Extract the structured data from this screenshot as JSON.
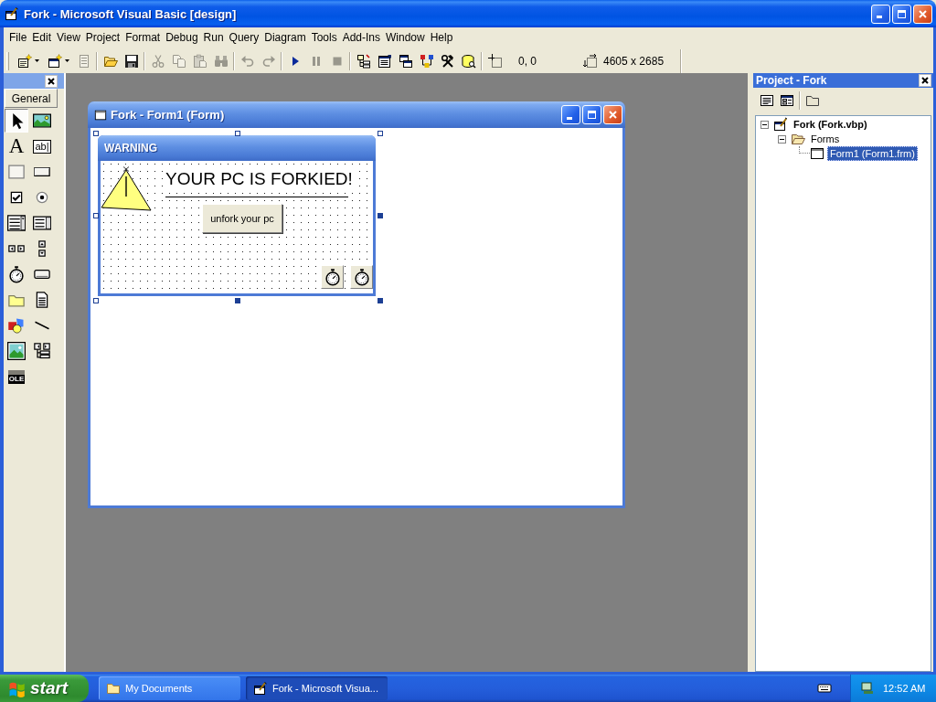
{
  "window": {
    "title": "Fork - Microsoft Visual Basic [design]"
  },
  "menu": [
    "File",
    "Edit",
    "View",
    "Project",
    "Format",
    "Debug",
    "Run",
    "Query",
    "Diagram",
    "Tools",
    "Add-Ins",
    "Window",
    "Help"
  ],
  "toolbar": {
    "groups": [
      [
        {
          "kind": "add-project",
          "dropdown": true,
          "disabled": false
        },
        {
          "kind": "add-form",
          "dropdown": true,
          "disabled": false
        },
        {
          "kind": "menu-editor",
          "disabled": true
        }
      ],
      [
        {
          "kind": "open",
          "disabled": false
        },
        {
          "kind": "save",
          "disabled": false
        }
      ],
      [
        {
          "kind": "cut",
          "disabled": true
        },
        {
          "kind": "copy",
          "disabled": true
        },
        {
          "kind": "paste",
          "disabled": true
        },
        {
          "kind": "find",
          "disabled": true
        }
      ],
      [
        {
          "kind": "undo",
          "disabled": true
        },
        {
          "kind": "redo",
          "disabled": true
        }
      ],
      [
        {
          "kind": "run",
          "disabled": false
        },
        {
          "kind": "pause",
          "disabled": true
        },
        {
          "kind": "stop",
          "disabled": true
        }
      ],
      [
        {
          "kind": "project-explorer",
          "disabled": false
        },
        {
          "kind": "properties",
          "disabled": false
        },
        {
          "kind": "form-layout",
          "disabled": false
        },
        {
          "kind": "object-browser",
          "disabled": false
        },
        {
          "kind": "toolbox",
          "disabled": false
        },
        {
          "kind": "data-view",
          "disabled": false
        }
      ]
    ],
    "position": "0, 0",
    "size": "4605 x 2685"
  },
  "toolbox": {
    "tab": "General",
    "tools": [
      {
        "kind": "pointer",
        "selected": true
      },
      {
        "kind": "picture-box",
        "selected": false
      },
      {
        "kind": "label",
        "text": "A",
        "selected": false
      },
      {
        "kind": "text-box",
        "text": "ab|",
        "selected": false
      },
      {
        "kind": "frame",
        "selected": false
      },
      {
        "kind": "command-button",
        "selected": false
      },
      {
        "kind": "check-box",
        "selected": false
      },
      {
        "kind": "option-button",
        "selected": false
      },
      {
        "kind": "combo-box",
        "selected": false
      },
      {
        "kind": "list-box",
        "selected": false
      },
      {
        "kind": "h-scroll",
        "selected": false
      },
      {
        "kind": "v-scroll",
        "selected": false
      },
      {
        "kind": "timer",
        "selected": false
      },
      {
        "kind": "drive-list",
        "selected": false
      },
      {
        "kind": "dir-list",
        "selected": false
      },
      {
        "kind": "file-list",
        "selected": false
      },
      {
        "kind": "shape",
        "selected": false
      },
      {
        "kind": "line",
        "selected": false
      },
      {
        "kind": "image",
        "selected": false
      },
      {
        "kind": "data",
        "selected": false
      },
      {
        "kind": "ole",
        "text": "OLE",
        "selected": false
      }
    ]
  },
  "form_window": {
    "title": "Fork - Form1 (Form)",
    "form": {
      "caption": "WARNING",
      "selected": true,
      "controls": [
        {
          "kind": "image"
        },
        {
          "kind": "label",
          "text": "YOUR PC IS FORKIED!"
        },
        {
          "kind": "line"
        },
        {
          "kind": "button",
          "text": "unfork your pc"
        },
        {
          "kind": "timer"
        },
        {
          "kind": "timer"
        }
      ]
    }
  },
  "project": {
    "title": "Project - Fork",
    "tree": [
      {
        "kind": "project",
        "label": "Fork (Fork.vbp)",
        "expanded": true,
        "selected": false,
        "children": [
          {
            "kind": "folder",
            "label": "Forms",
            "expanded": true,
            "selected": false,
            "children": [
              {
                "kind": "form",
                "label": "Form1 (Form1.frm)",
                "selected": true
              }
            ]
          }
        ]
      }
    ]
  },
  "taskbar": {
    "start": "start",
    "tasks": [
      {
        "kind": "folder",
        "label": "My Documents",
        "selected": false
      },
      {
        "kind": "app",
        "label": "Fork - Microsoft Visua...",
        "selected": true
      }
    ],
    "clock": "12:52 AM"
  }
}
